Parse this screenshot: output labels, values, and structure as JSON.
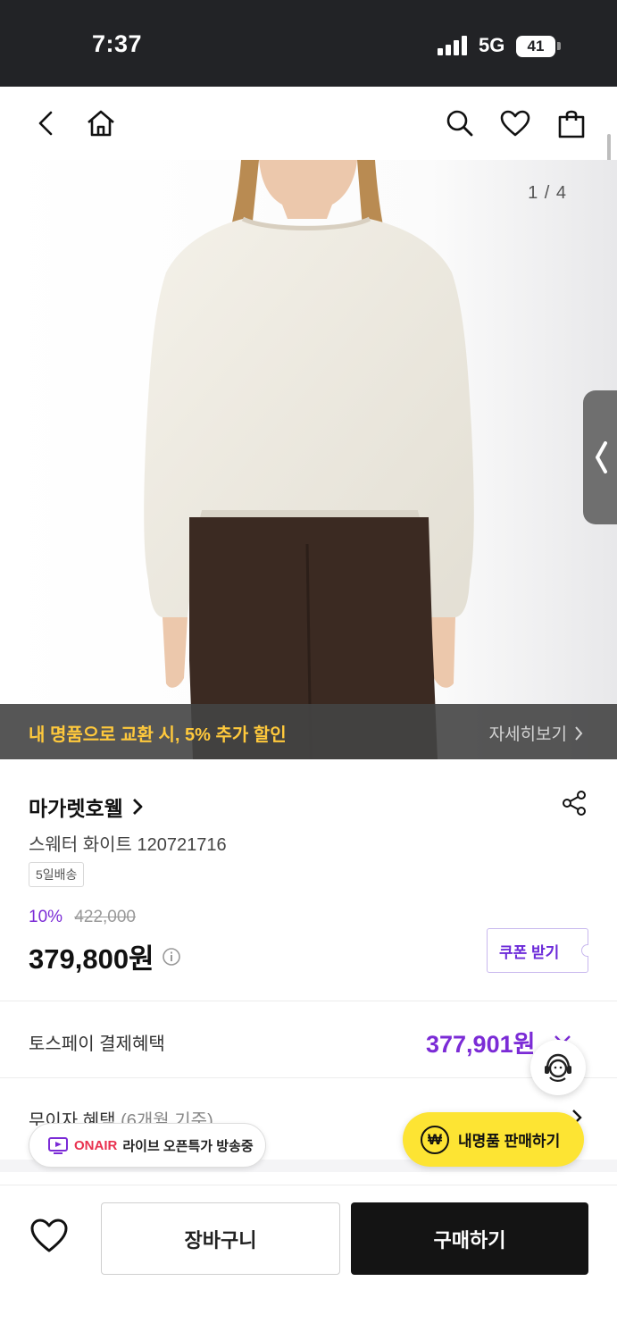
{
  "status_bar": {
    "time": "7:37",
    "network": "5G",
    "battery": "41"
  },
  "top_nav": {
    "back_icon": "back-arrow-icon",
    "home_icon": "home-icon",
    "search_icon": "search-icon",
    "wish_icon": "heart-icon",
    "bag_icon": "shopping-bag-icon"
  },
  "gallery": {
    "counter": "1 / 4",
    "side_tab_icon": "chevron-left-icon"
  },
  "promo": {
    "text": "내 명품으로 교환 시, 5% 추가 할인",
    "more_label": "자세히보기"
  },
  "product": {
    "brand": "마가렛호웰",
    "name": "스웨터 화이트 120721716",
    "shipping_badge": "5일배송",
    "discount_rate": "10%",
    "original_price": "422,000",
    "price": "379,800원",
    "coupon_label": "쿠폰 받기"
  },
  "benefits": {
    "toss_label": "토스페이 결제혜택",
    "toss_price": "377,901원",
    "no_interest_label": "무이자 혜택",
    "no_interest_sub": "(6개월 기준)"
  },
  "floating": {
    "onair_tag": "ONAIR",
    "onair_text": "라이브 오픈특가 방송중",
    "sell_symbol": "₩",
    "sell_label": "내명품 판매하기"
  },
  "bottom_bar": {
    "cart_label": "장바구니",
    "buy_label": "구매하기"
  },
  "colors": {
    "accent": "#7b2bd6",
    "promo_text": "#ffc93c",
    "sell_button": "#fde433",
    "buy_button": "#141414",
    "onair": "#e9314f"
  }
}
